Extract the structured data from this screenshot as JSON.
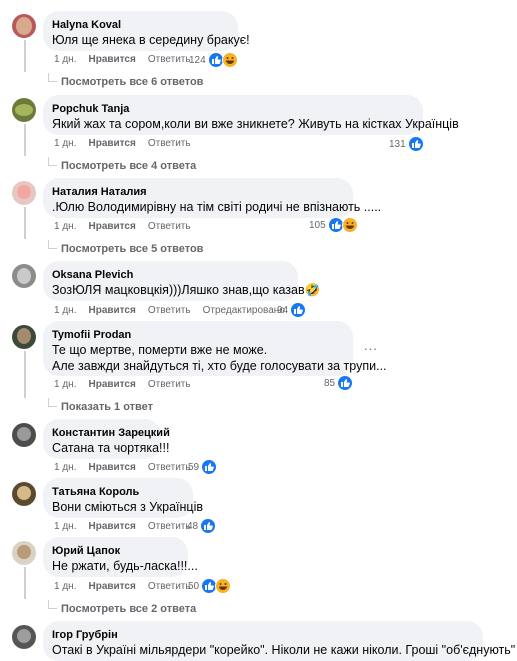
{
  "comments": [
    {
      "author": "Halyna Koval",
      "text": [
        "Юля ще янека в середину бракує!"
      ],
      "time": "1 дн.",
      "like_label": "Нравится",
      "reply_label": "Ответить",
      "count": "124",
      "reactions": [
        "like",
        "haha"
      ],
      "replies": "Посмотреть все 6 ответов"
    },
    {
      "author": "Popchuk Tanja",
      "text": [
        "Який жах та сором,коли ви вже зникнете? Живуть на кістках Українців"
      ],
      "time": "1 дн.",
      "like_label": "Нравится",
      "reply_label": "Ответить",
      "count": "131",
      "reactions": [
        "like"
      ],
      "replies": "Посмотреть все 4 ответа"
    },
    {
      "author": "Наталия Наталия",
      "text": [
        ".Юлю Володимирівну на тім світі родичі не впізнають ....."
      ],
      "time": "1 дн.",
      "like_label": "Нравится",
      "reply_label": "Ответить",
      "count": "105",
      "reactions": [
        "like",
        "haha"
      ],
      "replies": "Посмотреть все 5 ответов"
    },
    {
      "author": "Oksana Plevich",
      "text": [
        "ЗозЮЛЯ мацковцкія)))Ляшко знав,що казав🤣"
      ],
      "time": "1 дн.",
      "like_label": "Нравится",
      "reply_label": "Ответить",
      "edited_label": "Отредактировано",
      "count": "94",
      "reactions": [
        "like"
      ]
    },
    {
      "author": "Tymofii Prodan",
      "text": [
        "Те що мертве, померти вже не може.",
        "Але завжди знайдуться ті, хто буде голосувати за трупи..."
      ],
      "time": "1 дн.",
      "like_label": "Нравится",
      "reply_label": "Ответить",
      "count": "85",
      "reactions": [
        "like"
      ],
      "replies": "Показать 1 ответ",
      "more": "..."
    },
    {
      "author": "Константин Зарецкий",
      "text": [
        "Сатана та чортяка!!!"
      ],
      "time": "1 дн.",
      "like_label": "Нравится",
      "reply_label": "Ответить",
      "count": "59",
      "reactions": [
        "like"
      ]
    },
    {
      "author": "Татьяна Король",
      "text": [
        "Вони сміються з Українців"
      ],
      "time": "1 дн.",
      "like_label": "Нравится",
      "reply_label": "Ответить",
      "count": "48",
      "reactions": [
        "like"
      ]
    },
    {
      "author": "Юрий Цапок",
      "text": [
        "Не ржати, будь-ласка!!!..."
      ],
      "time": "1 дн.",
      "like_label": "Нравится",
      "reply_label": "Ответить",
      "count": "50",
      "reactions": [
        "like",
        "haha"
      ],
      "replies": "Посмотреть все 2 ответа"
    },
    {
      "author": "Ігор Грубрін",
      "text": [
        "Отакі в Україні мільярдери \"корейко\". Ніколи не кажи ніколи. Гроші \"об'єднують\""
      ]
    }
  ],
  "colors": {
    "like": "#1877f2",
    "haha": "#f7b125",
    "bubble": "#f0f2f5",
    "meta": "#65676b"
  }
}
